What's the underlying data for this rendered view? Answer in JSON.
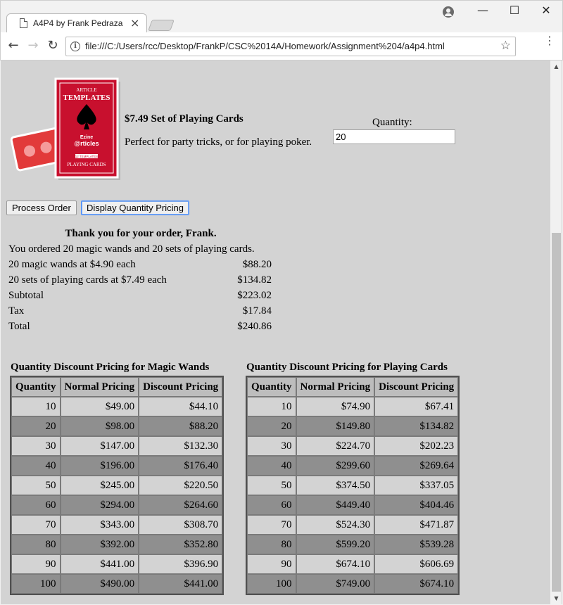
{
  "browser": {
    "tab_title": "A4P4 by Frank Pedraza",
    "tab_close": "×",
    "url": "file:///C:/Users/rcc/Desktop/FrankP/CSC%2014A/Homework/Assignment%204/a4p4.html",
    "window_controls": {
      "minimize": "—",
      "maximize": "☐",
      "close": "✕"
    },
    "nav": {
      "back": "←",
      "forward": "→",
      "reload": "↻"
    },
    "star": "☆",
    "menu": "⋮"
  },
  "product": {
    "image_icon": "playing-cards-box",
    "title": "$7.49 Set of Playing Cards",
    "description": "Perfect for party tricks, or for playing poker.",
    "quantity_label": "Quantity:",
    "quantity_value": "20",
    "image_text": {
      "line1": "ARTICLE",
      "line2": "TEMPLATES",
      "line3": "Ezine",
      "line4": "@rticles",
      "line5": "12 TEMPLATES",
      "line6": "PLAYING CARDS"
    }
  },
  "buttons": {
    "process_order": "Process Order",
    "display_pricing": "Display Quantity Pricing"
  },
  "receipt": {
    "thanks": "Thank you for your order, Frank.",
    "summary": "You ordered 20 magic wands and 20 sets of playing cards.",
    "lines": [
      {
        "label": "20 magic wands at $4.90 each",
        "amount": "$88.20"
      },
      {
        "label": "20 sets of playing cards at $7.49 each",
        "amount": "$134.82"
      },
      {
        "label": "Subtotal",
        "amount": "$223.02"
      },
      {
        "label": "Tax",
        "amount": "$17.84"
      },
      {
        "label": "Total",
        "amount": "$240.86"
      }
    ]
  },
  "tables": [
    {
      "caption": "Quantity Discount Pricing for Magic Wands",
      "headers": [
        "Quantity",
        "Normal Pricing",
        "Discount Pricing"
      ],
      "rows": [
        [
          "10",
          "$49.00",
          "$44.10"
        ],
        [
          "20",
          "$98.00",
          "$88.20"
        ],
        [
          "30",
          "$147.00",
          "$132.30"
        ],
        [
          "40",
          "$196.00",
          "$176.40"
        ],
        [
          "50",
          "$245.00",
          "$220.50"
        ],
        [
          "60",
          "$294.00",
          "$264.60"
        ],
        [
          "70",
          "$343.00",
          "$308.70"
        ],
        [
          "80",
          "$392.00",
          "$352.80"
        ],
        [
          "90",
          "$441.00",
          "$396.90"
        ],
        [
          "100",
          "$490.00",
          "$441.00"
        ]
      ]
    },
    {
      "caption": "Quantity Discount Pricing for Playing Cards",
      "headers": [
        "Quantity",
        "Normal Pricing",
        "Discount Pricing"
      ],
      "rows": [
        [
          "10",
          "$74.90",
          "$67.41"
        ],
        [
          "20",
          "$149.80",
          "$134.82"
        ],
        [
          "30",
          "$224.70",
          "$202.23"
        ],
        [
          "40",
          "$299.60",
          "$269.64"
        ],
        [
          "50",
          "$374.50",
          "$337.05"
        ],
        [
          "60",
          "$449.40",
          "$404.46"
        ],
        [
          "70",
          "$524.30",
          "$471.87"
        ],
        [
          "80",
          "$599.20",
          "$539.28"
        ],
        [
          "90",
          "$674.10",
          "$606.69"
        ],
        [
          "100",
          "$749.00",
          "$674.10"
        ]
      ]
    }
  ],
  "colors": {
    "page_bg": "#d3d3d3",
    "row_light": "#d3d3d3",
    "row_dark": "#8f8f8f",
    "header_bg": "#bdbdbd",
    "card_red": "#c8102e"
  },
  "scrollbar": {
    "up": "▲",
    "down": "▼"
  }
}
